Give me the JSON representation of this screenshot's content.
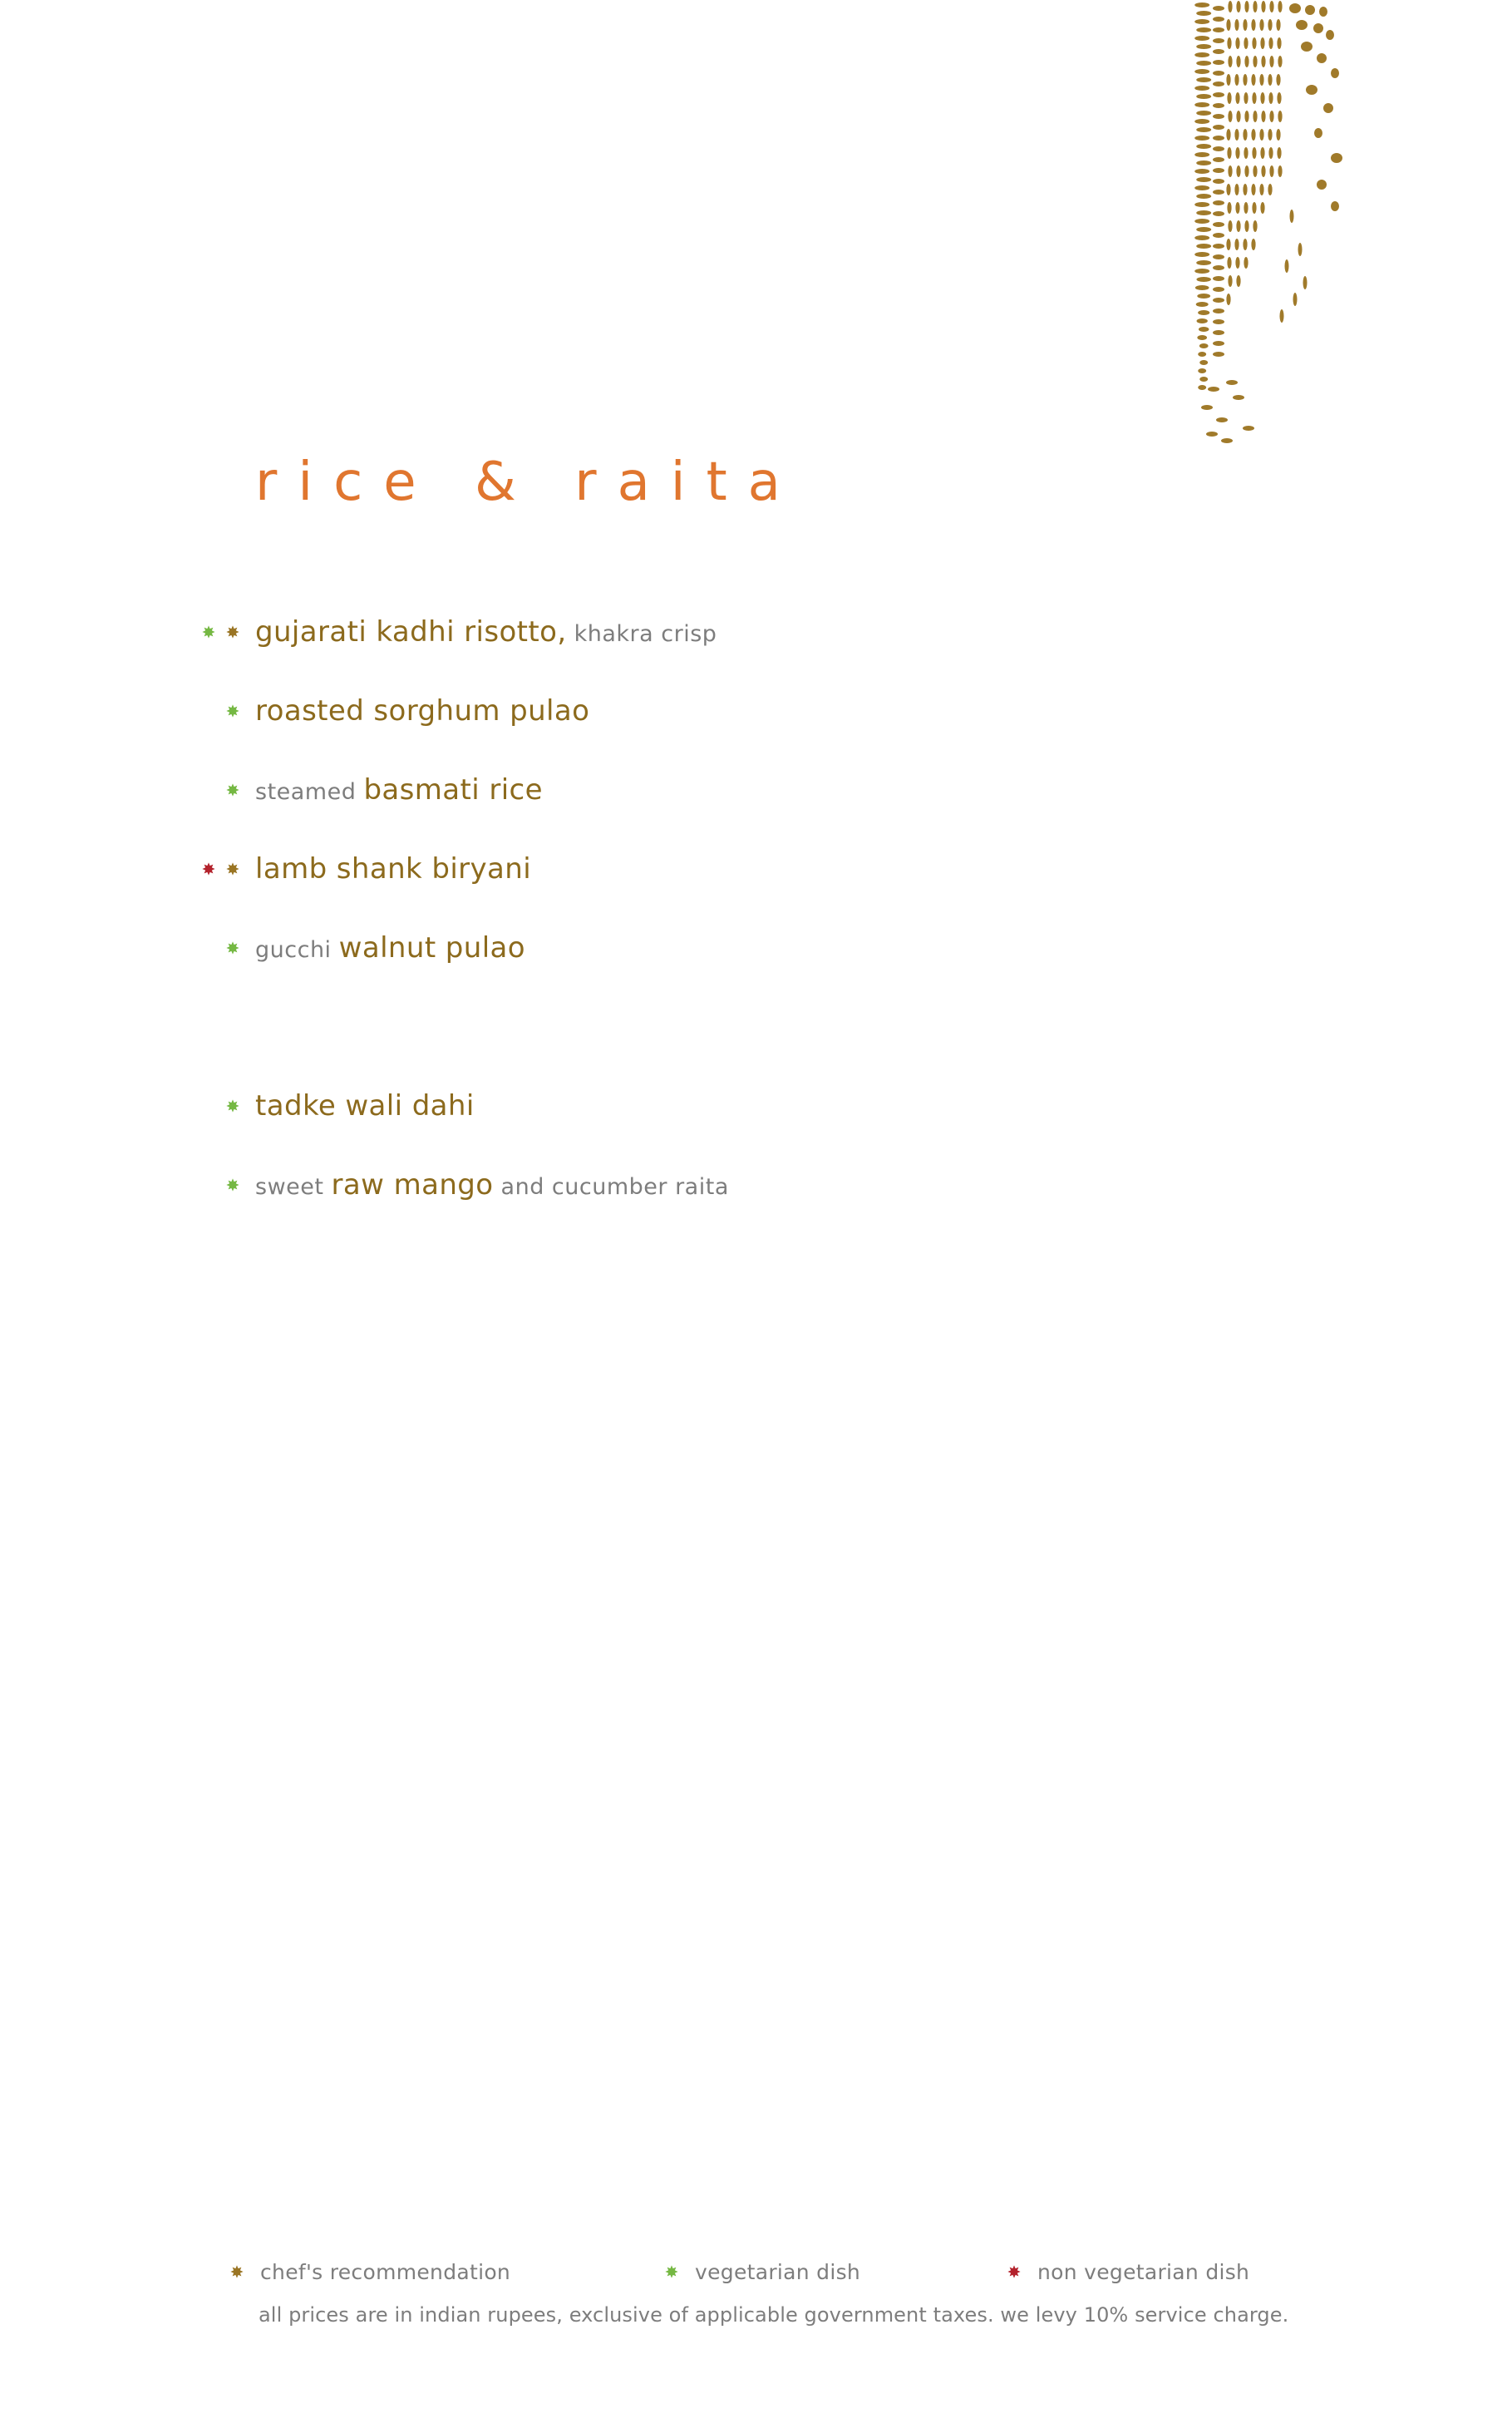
{
  "colors": {
    "title": "#e0762f",
    "dish": "#8c6a1d",
    "muted": "#7d7d7d",
    "chef": "#9a7524",
    "veg": "#75b843",
    "nonveg": "#b3222c",
    "pattern": "#a07a2a"
  },
  "page": {
    "title": "rice & raita"
  },
  "menu": {
    "items": [
      {
        "parts": [
          {
            "text": "gujarati kadhi risotto,",
            "style": "strong"
          },
          {
            "text": " khakra crisp",
            "style": "muted"
          }
        ],
        "marker": "chef",
        "extra_marker": "veg"
      },
      {
        "parts": [
          {
            "text": "roasted sorghum pulao",
            "style": "strong"
          }
        ],
        "marker": "veg",
        "extra_marker": null
      },
      {
        "parts": [
          {
            "text": "steamed ",
            "style": "muted"
          },
          {
            "text": "basmati rice",
            "style": "strong"
          }
        ],
        "marker": "veg",
        "extra_marker": null
      },
      {
        "parts": [
          {
            "text": "lamb shank biryani",
            "style": "strong"
          }
        ],
        "marker": "chef",
        "extra_marker": "nonveg"
      },
      {
        "parts": [
          {
            "text": "gucchi ",
            "style": "muted"
          },
          {
            "text": "walnut pulao",
            "style": "strong"
          }
        ],
        "marker": "veg",
        "extra_marker": null
      },
      {
        "parts": [
          {
            "text": "tadke wali dahi",
            "style": "strong"
          }
        ],
        "marker": "veg",
        "extra_marker": null
      },
      {
        "parts": [
          {
            "text": "sweet ",
            "style": "muted"
          },
          {
            "text": "raw mango",
            "style": "strong"
          },
          {
            "text": " and cucumber raita",
            "style": "muted"
          }
        ],
        "marker": "veg",
        "extra_marker": null
      }
    ]
  },
  "legend": {
    "chef_label": "chef's recommendation",
    "veg_label": "vegetarian dish",
    "nonveg_label": "non vegetarian dish"
  },
  "footer": {
    "note": "all prices are in indian rupees, exclusive of applicable government taxes. we levy 10% service charge."
  }
}
